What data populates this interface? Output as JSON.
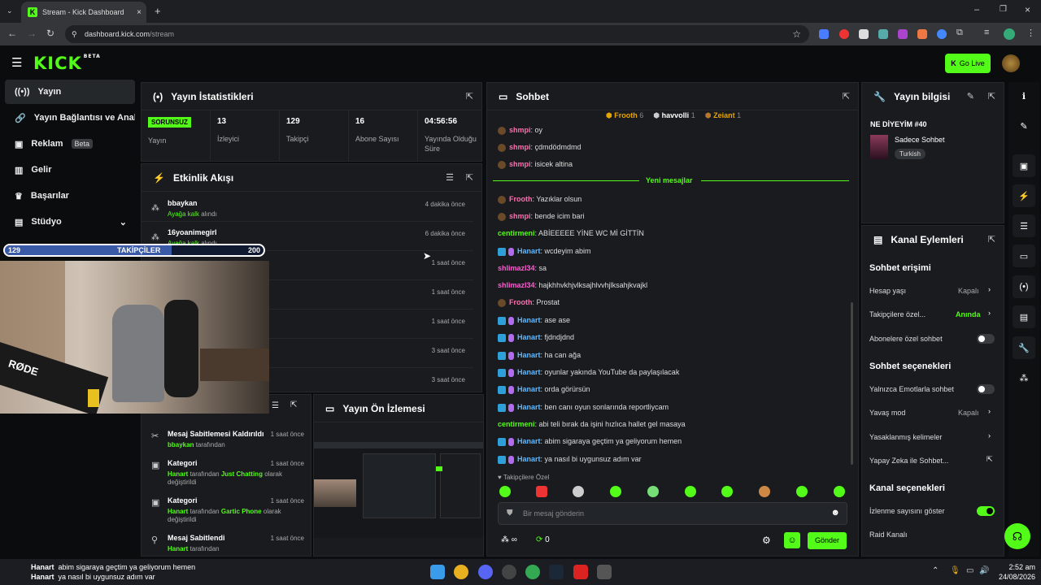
{
  "browser": {
    "tab_title": "Stream - Kick Dashboard",
    "url": "dashboard.kick.com",
    "url_path": "/stream"
  },
  "header": {
    "logo": "KICK",
    "logo_badge": "BETA",
    "go_live": "Go Live"
  },
  "sidebar": {
    "items": [
      {
        "label": "Yayın",
        "icon": "broadcast-icon"
      },
      {
        "label": "Yayın Bağlantısı ve Anahtar",
        "icon": "link-icon"
      },
      {
        "label": "Reklam",
        "badge": "Beta",
        "icon": "ad-icon"
      },
      {
        "label": "Gelir",
        "icon": "chart-icon"
      },
      {
        "label": "Başarılar",
        "icon": "trophy-icon"
      },
      {
        "label": "Stüdyo",
        "icon": "studio-icon"
      }
    ]
  },
  "stats": {
    "title": "Yayın İstatistikleri",
    "items": [
      {
        "value": "SORUNSUZ",
        "label": "Yayın"
      },
      {
        "value": "13",
        "label": "İzleyici"
      },
      {
        "value": "129",
        "label": "Takipçi"
      },
      {
        "value": "16",
        "label": "Abone Sayısı"
      },
      {
        "value": "04:56:56",
        "label": "Yayında Olduğu Süre"
      }
    ]
  },
  "activity": {
    "title": "Etkinlik Akışı",
    "rows": [
      {
        "name": "bbaykan",
        "action": "Ayağa kalk",
        "suffix": "alındı",
        "time": "4 dakika önce"
      },
      {
        "name": "16yoanimegirl",
        "action": "Ayağa kalk",
        "suffix": "alındı",
        "time": "6 dakika önce"
      },
      {
        "name": "",
        "action": "",
        "suffix": "",
        "time": "1 saat önce"
      },
      {
        "name": "",
        "action": "",
        "suffix": "",
        "time": "1 saat önce"
      },
      {
        "name": "",
        "action": "",
        "suffix": "",
        "time": "1 saat önce"
      },
      {
        "name": "",
        "action": "",
        "suffix": "",
        "time": "3 saat önce"
      },
      {
        "name": "",
        "action": "",
        "suffix": "",
        "time": "3 saat önce"
      }
    ]
  },
  "modlog": {
    "rows": [
      {
        "title": "Mesaj Sabitlemesi Kaldırıldı",
        "by": "bbaykan",
        "by_suffix": "tarafından",
        "time": "1 saat önce"
      },
      {
        "title": "Kategori",
        "by": "Hanart",
        "by_suffix": "tarafından",
        "target": "Just Chatting",
        "rest": "olarak değiştirildi",
        "time": "1 saat önce"
      },
      {
        "title": "Kategori",
        "by": "Hanart",
        "by_suffix": "tarafından",
        "target": "Gartic Phone",
        "rest": "olarak değiştirildi",
        "time": "1 saat önce"
      },
      {
        "title": "Mesaj Sabitlendi",
        "by": "Hanart",
        "by_suffix": "tarafından",
        "time": "1 saat önce"
      }
    ]
  },
  "preview": {
    "title": "Yayın Ön İzlemesi"
  },
  "chat": {
    "title": "Sohbet",
    "top_gifters": [
      {
        "name": "Frooth",
        "count": "6",
        "rank": "1"
      },
      {
        "name": "havvolli",
        "count": "1",
        "rank": "2"
      },
      {
        "name": "Zeiant",
        "count": "1",
        "rank": "3"
      }
    ],
    "new_messages": "Yeni mesajlar",
    "messages": [
      {
        "user": "shmpi",
        "text": "oy",
        "color": "#ff6fb0",
        "badge": "pin"
      },
      {
        "user": "shmpi",
        "text": "çdmdödmdmd",
        "color": "#ff6fb0",
        "badge": "pin"
      },
      {
        "user": "shmpi",
        "text": "isicek altina",
        "color": "#ff6fb0",
        "badge": "pin"
      },
      {
        "user": "Frooth",
        "text": "Yazıklar olsun",
        "color": "#ff6fb0",
        "badge": "pin"
      },
      {
        "user": "shmpi",
        "text": "bende icim bari",
        "color": "#ff6fb0",
        "badge": "pin"
      },
      {
        "user": "centirmeni",
        "text": "ABİEEEEE YİNE WC Mİ GİTTİN",
        "color": "#53fc18",
        "badge": ""
      },
      {
        "user": "Hanart",
        "text": "wcdeyim abim",
        "color": "#5fb8ff",
        "badge": "mod"
      },
      {
        "user": "shlimazl34",
        "text": "sa",
        "color": "#ff5ad1",
        "badge": ""
      },
      {
        "user": "shlimazl34",
        "text": "hajkhhvkhjvlksajhlvvhjlksahjkvajkl",
        "color": "#ff5ad1",
        "badge": ""
      },
      {
        "user": "Frooth",
        "text": "Prostat",
        "color": "#ff6fb0",
        "badge": "pin"
      },
      {
        "user": "Hanart",
        "text": "ase ase",
        "color": "#5fb8ff",
        "badge": "mod"
      },
      {
        "user": "Hanart",
        "text": "fjdndjdnd",
        "color": "#5fb8ff",
        "badge": "mod"
      },
      {
        "user": "Hanart",
        "text": "ha can ağa",
        "color": "#5fb8ff",
        "badge": "mod"
      },
      {
        "user": "Hanart",
        "text": "oyunlar yakında YouTube da paylaşılacak",
        "color": "#5fb8ff",
        "badge": "mod"
      },
      {
        "user": "Hanart",
        "text": "orda görürsün",
        "color": "#5fb8ff",
        "badge": "mod"
      },
      {
        "user": "Hanart",
        "text": "ben canı oyun sonlarında reportliycam",
        "color": "#5fb8ff",
        "badge": "mod"
      },
      {
        "user": "centirmeni",
        "text": "abi teli bırak da işini hızlıca hallet gel masaya",
        "color": "#53fc18",
        "badge": ""
      },
      {
        "user": "Hanart",
        "text": "abim sigaraya geçtim ya geliyorum hemen",
        "color": "#5fb8ff",
        "badge": "mod"
      },
      {
        "user": "Hanart",
        "text": "ya nasıl bi uygunsuz adım var",
        "color": "#5fb8ff",
        "badge": "mod"
      }
    ],
    "followers_only": "Takipçilere Özel",
    "input_placeholder": "Bir mesaj gönderin",
    "send": "Gönder",
    "viewers_symbol": "∞",
    "points": "0"
  },
  "streaminfo": {
    "title": "Yayın bilgisi",
    "stream_title": "NE DİYEYİM #40",
    "category": "Sadece Sohbet",
    "tag": "Turkish"
  },
  "channel": {
    "title": "Kanal Eylemleri",
    "chat_access": "Sohbet erişimi",
    "account_age": "Hesap yaşı",
    "account_age_val": "Kapalı",
    "followers_only": "Takipçilere özel...",
    "followers_only_val": "Anında",
    "subs_only": "Abonelere özel sohbet",
    "chat_options": "Sohbet seçenekleri",
    "emote_only": "Yalnızca Emotlarla sohbet",
    "slow_mode": "Yavaş mod",
    "slow_mode_val": "Kapalı",
    "banned_words": "Yasaklanmış kelimeler",
    "ai_chat": "Yapay Zeka ile Sohbet...",
    "channel_options": "Kanal seçenekleri",
    "show_viewers": "İzlenme sayısını göster",
    "raid": "Raid Kanalı"
  },
  "overlay": {
    "followers_label": "TAKİPÇİLER",
    "current": "129",
    "goal": "200",
    "progress": 0.645,
    "webcam_brand": "RØDE"
  },
  "taskbar": {
    "ticker": [
      {
        "user": "Hanart",
        "text": "abim sigaraya geçtim ya geliyorum hemen"
      },
      {
        "user": "Hanart",
        "text": "ya nasıl bi uygunsuz adım var"
      }
    ],
    "time": "2:52 am",
    "date": "24/08/2026"
  }
}
